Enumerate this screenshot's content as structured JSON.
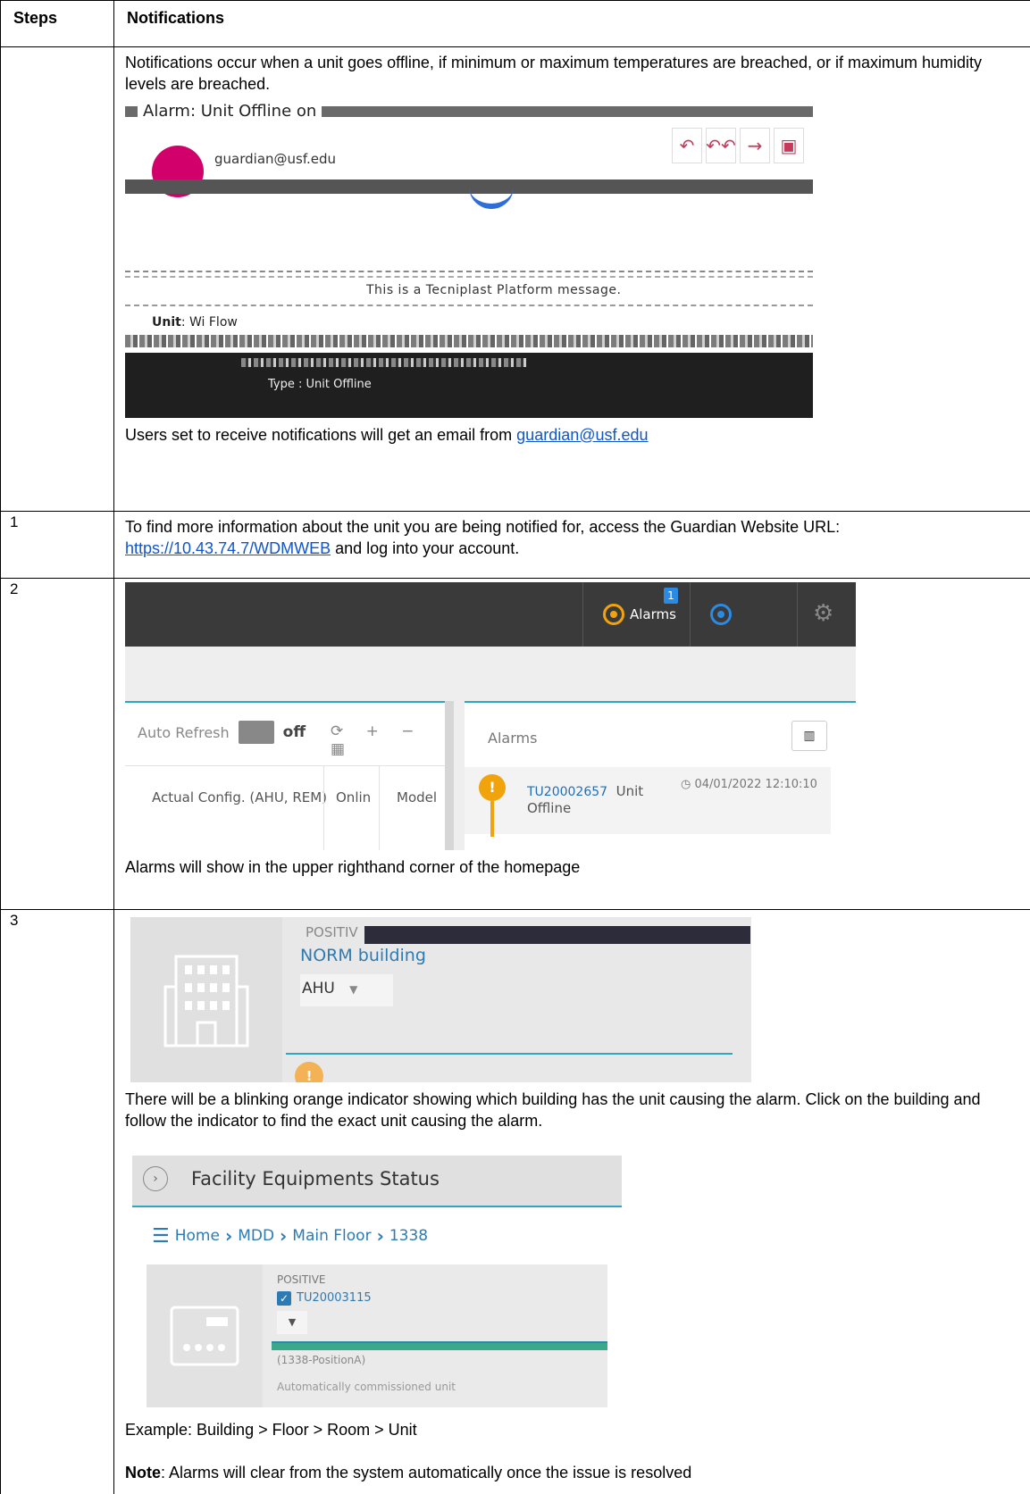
{
  "table": {
    "col_steps": "Steps",
    "col_notifications": "Notifications"
  },
  "intro": {
    "text": "Notifications occur when a unit goes offline, if minimum or maximum temperatures are breached, or if maximum humidity levels are breached.",
    "email": {
      "subject": "Alarm: Unit Offline on",
      "sender": "guardian@usf.edu",
      "platform_msg": "This is a Tecniplast Platform message.",
      "unit_label": "Unit",
      "unit_value": ": Wi Flow",
      "type_text": "Type : Unit Offline",
      "actions": [
        "↶",
        "↶↶",
        "→",
        "▣"
      ]
    },
    "after_prefix": "Users set to receive notifications will get an email from ",
    "after_link": "guardian@usf.edu"
  },
  "step1": {
    "num": "1",
    "text": "To find more information about the unit you are being notified for, access the Guardian Website URL: ",
    "url": "https://10.43.74.7/WDMWEB",
    "suffix": "  and log into your account."
  },
  "step2": {
    "num": "2",
    "screen": {
      "alarms_label": "Alarms",
      "badge": "1",
      "auto_refresh": "Auto Refresh",
      "toggle_state": "off",
      "tools": "⟳ + − ▦",
      "col1": "Actual Config. (AHU, REM)",
      "col2": "Onlin",
      "col3": "Model",
      "panel_title": "Alarms",
      "unit_id": "TU20002657",
      "unit_desc": "Unit Offline",
      "timestamp": "04/01/2022 12:10:10"
    },
    "caption": "Alarms will show in the upper righthand corner of the homepage"
  },
  "step3": {
    "num": "3",
    "building": {
      "pos": "POSITIV",
      "name": "NORM building",
      "ahu": "AHU"
    },
    "text": "There will be a blinking orange indicator showing which building has the unit causing the alarm. Click on the building and follow the indicator to find the exact unit causing the alarm.",
    "facility": {
      "title": "Facility Equipments Status",
      "crumbs": [
        "Home",
        "MDD",
        "Main Floor",
        "1338"
      ],
      "pos": "POSITIVE",
      "unit": "TU20003115",
      "loc": "(1338-PositionA)",
      "auto": "Automatically commissioned unit"
    },
    "example": "Example:  Building > Floor > Room > Unit",
    "note_label": "Note",
    "note_text": ": Alarms will clear from the system automatically once the issue is resolved"
  }
}
